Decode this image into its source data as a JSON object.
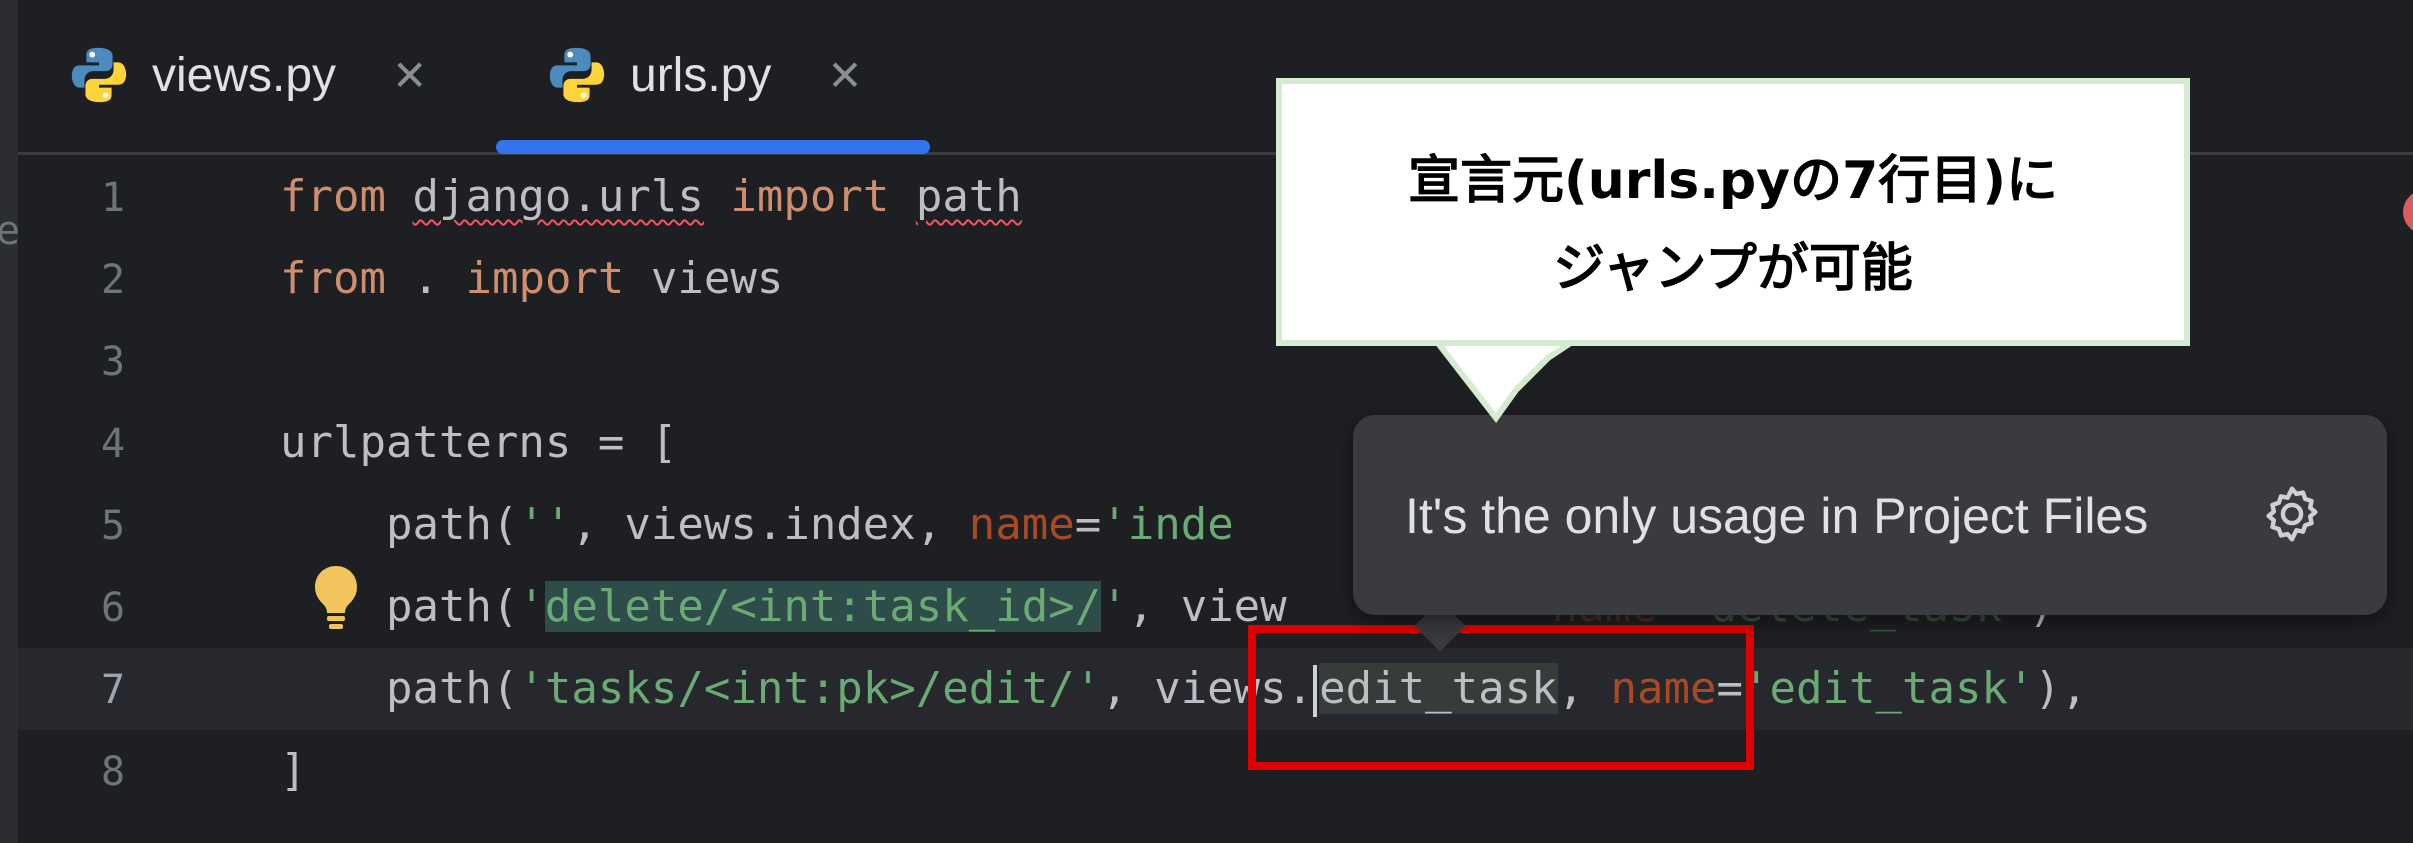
{
  "tabs": [
    {
      "label": "views.py",
      "close": "✕",
      "active": false
    },
    {
      "label": "urls.py",
      "close": "✕",
      "active": true
    }
  ],
  "gutter": {
    "line_numbers": [
      "1",
      "2",
      "3",
      "4",
      "5",
      "6",
      "7",
      "8"
    ],
    "current_line": "7"
  },
  "code": {
    "l1": {
      "kw1": "from",
      "mod": "django.urls",
      "kw2": "import",
      "name": "path"
    },
    "l2": {
      "kw1": "from",
      "dot": ".",
      "kw2": "import",
      "name": "views"
    },
    "l4": {
      "text": "urlpatterns = ["
    },
    "l5": {
      "pre": "    path(",
      "str1": "''",
      "mid": ", views.index, ",
      "param": "name",
      "eq": "=",
      "str2": "'inde"
    },
    "l6": {
      "pre": "    path(",
      "q1": "'",
      "hl": "delete/<int:task_id>/",
      "q2": "'",
      "mid": ", view",
      "tail_param": "name",
      "tail": "=",
      "str2": "'delete_task'",
      "close": ")"
    },
    "l7": {
      "pre": "    path(",
      "str1": "'tasks/<int:pk>/edit/'",
      "mid1": ", views.",
      "usage": "edit_task",
      "mid2": ", ",
      "param": "name",
      "eq": "=",
      "str2": "'edit_task'",
      "end": "),"
    },
    "l8": {
      "text": "]"
    }
  },
  "popup": {
    "text": "It's the only usage in Project Files",
    "icon": "gear-icon"
  },
  "callout": {
    "line1": "宣言元(urls.pyの7行目)に",
    "line2": "ジャンプが可能"
  },
  "colors": {
    "editor_bg": "#1e1f22",
    "keyword": "#cf8e6d",
    "string": "#6aab73",
    "param": "#aa4926",
    "accent": "#3574f0",
    "highlight_box": "#e00000"
  }
}
